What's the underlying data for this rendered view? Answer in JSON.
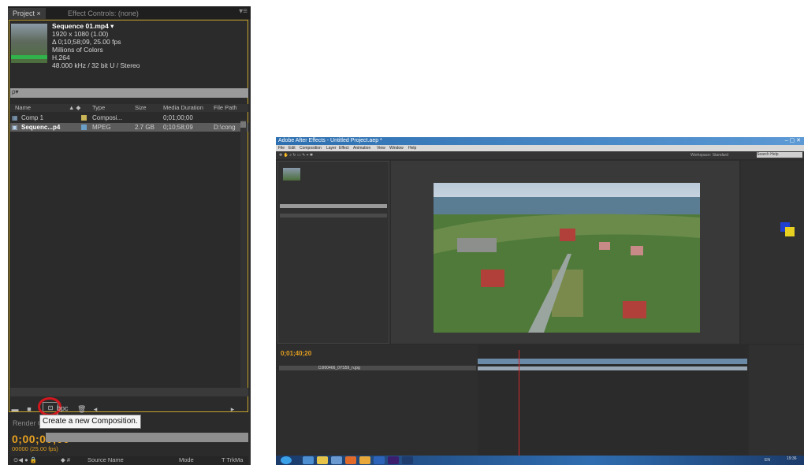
{
  "left_panel": {
    "tabs": {
      "project": "Project",
      "effect_controls": "Effect Controls: (none)"
    },
    "footage_info": {
      "name": "Sequence 01.mp4 ▾",
      "resolution": "1920 x 1080 (1.00)",
      "duration": "Δ 0;10;58;09, 25.00 fps",
      "colors": "Millions of Colors",
      "codec": "H.264",
      "audio": "48.000 kHz / 32 bit U / Stereo"
    },
    "search": {
      "icon": "search-icon",
      "glyph": "ρ▾"
    },
    "columns": [
      "Name",
      "Type",
      "Size",
      "Media Duration",
      "File Path"
    ],
    "items": [
      {
        "name": "Comp 1",
        "type": "Composi...",
        "size": "",
        "duration": "0;01;00;00",
        "path": "",
        "label_color": "#c9b458",
        "icon": "composition-icon"
      },
      {
        "name": "Sequenc...p4",
        "type": "MPEG",
        "size": "2.7 GB",
        "duration": "0;10;58;09",
        "path": "D:\\cong",
        "label_color": "#6aa0c8",
        "icon": "footage-icon"
      }
    ],
    "bpc": "bpc",
    "tooltip": "Create a new Composition.",
    "render_queue": "Render Queue",
    "timecode": "0;00;00;00",
    "frame_fps": "00000 (25.00 fps)",
    "timeline_columns": {
      "source_name": "Source Name",
      "mode": "Mode",
      "trkmat": "T  TrkMa"
    }
  },
  "ae_window": {
    "title": "Adobe After Effects - Untitled Project.aep *",
    "menu": [
      "File",
      "Edit",
      "Composition",
      "Layer",
      "Effect",
      "Animation",
      "View",
      "Window",
      "Help"
    ],
    "search_help": "Search Help",
    "workspace": "Workspace: Standard",
    "timecode": "0;01;40;20",
    "layer_name": "DJI00466_0YS59_n.jpg",
    "zoom": "50%",
    "tray_time": "19:36",
    "tray_lang": "EN"
  },
  "colors": {
    "accent_timecode": "#e6a020",
    "highlight_border": "#c6a32c",
    "red_annotation": "#d4161d"
  }
}
